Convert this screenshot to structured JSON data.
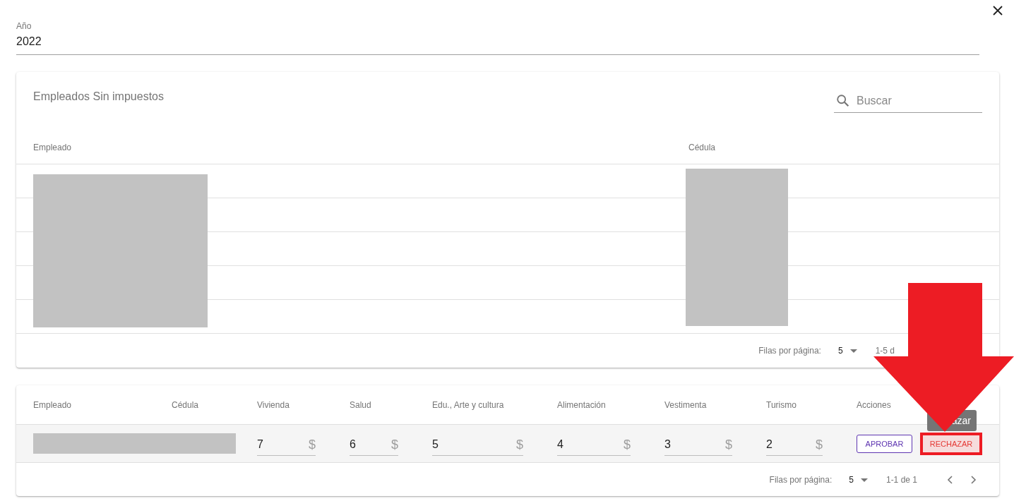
{
  "year_field": {
    "label": "Año",
    "value": "2022"
  },
  "employees_card": {
    "title": "Empleados Sin impuestos",
    "search": {
      "placeholder": "Buscar"
    },
    "columns": [
      "Empleado",
      "Cédula"
    ],
    "pagination": {
      "label": "Filas por página:",
      "rows_per_page": "5",
      "range": "1-5 d"
    }
  },
  "deductions_card": {
    "columns": [
      "Empleado",
      "Cédula",
      "Vivienda",
      "Salud",
      "Edu., Arte y cultura",
      "Alimentación",
      "Vestimenta",
      "Turismo",
      "Acciones"
    ],
    "rows": [
      {
        "amounts": [
          {
            "value": "7",
            "currency": "$"
          },
          {
            "value": "6",
            "currency": "$"
          },
          {
            "value": "5",
            "currency": "$"
          },
          {
            "value": "4",
            "currency": "$"
          },
          {
            "value": "3",
            "currency": "$"
          },
          {
            "value": "2",
            "currency": "$"
          }
        ],
        "actions": [
          {
            "kind": "outlined",
            "label": "APROBAR",
            "highlighted": false
          },
          {
            "kind": "danger",
            "label": "RECHAZAR",
            "highlighted": true
          }
        ]
      }
    ],
    "tooltip": "azar",
    "pagination": {
      "label": "Filas por página:",
      "rows_per_page": "5",
      "range": "1-1 de 1"
    }
  }
}
